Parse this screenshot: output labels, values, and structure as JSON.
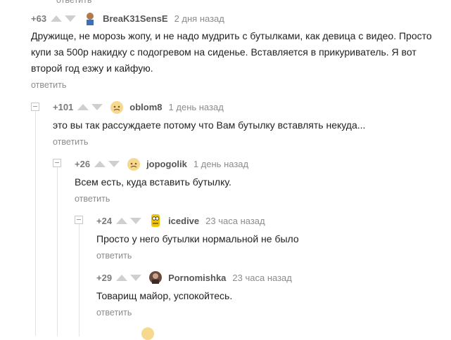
{
  "reply_label": "ответить",
  "comments": [
    {
      "rating": "+63",
      "user": "BreaK31SensE",
      "time": "2 дня назад",
      "text": "Дружище, не морозь жопу, и не надо мудрить с бутылками, как девица с видео. Просто купи за 500р накидку с подогревом на сиденье. Вставляется в прикуриватель. Я вот второй год езжу и кайфую."
    },
    {
      "rating": "+101",
      "user": "oblom8",
      "time": "1 день назад",
      "text": "это вы так рассуждаете потому что Вам бутылку вставлять некуда..."
    },
    {
      "rating": "+26",
      "user": "jopogolik",
      "time": "1 день назад",
      "text": "Всем есть, куда вставить бутылку."
    },
    {
      "rating": "+24",
      "user": "icedive",
      "time": "23 часа назад",
      "text": "Просто у него бутылки нормальной не было"
    },
    {
      "rating": "+29",
      "user": "Pornomishka",
      "time": "23 часа назад",
      "text": "Товарищ майор, успокойтесь."
    }
  ],
  "colors": {
    "meta": "#8c8c8c",
    "vote_arrow": "#cfcfcf",
    "thread_line": "#e3e3e3"
  }
}
